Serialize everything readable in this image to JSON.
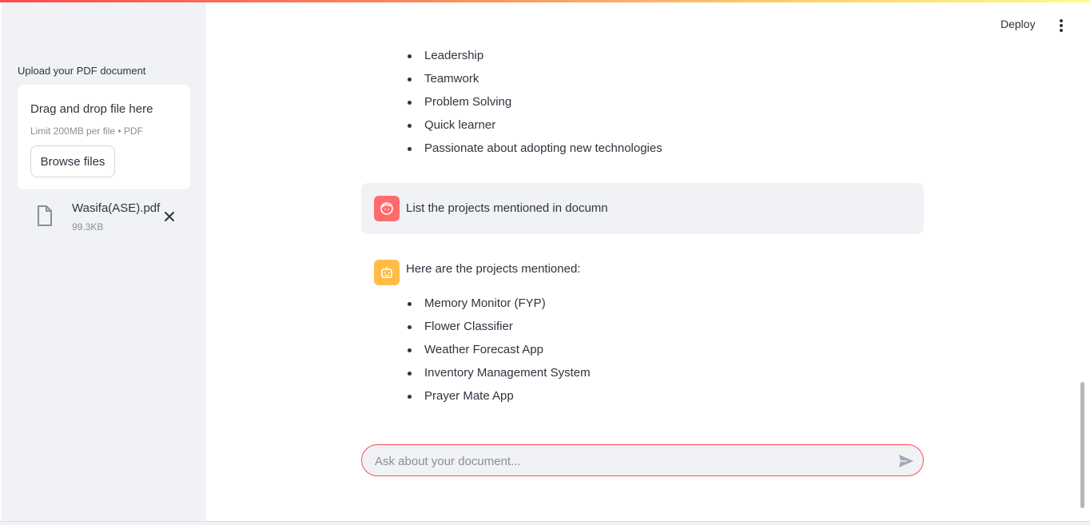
{
  "header": {
    "deploy_label": "Deploy",
    "menu_icon": "kebab-menu-icon"
  },
  "sidebar": {
    "upload_label": "Upload your PDF document",
    "dropzone": {
      "title": "Drag and drop file here",
      "limit": "Limit 200MB per file • PDF",
      "browse_label": "Browse files"
    },
    "file": {
      "name": "Wasifa(ASE).pdf",
      "size": "99.3KB",
      "icon": "file-icon",
      "remove_icon": "close-icon"
    }
  },
  "chat": {
    "previous_bullets": [
      "Leadership",
      "Teamwork",
      "Problem Solving",
      "Quick learner",
      "Passionate about adopting new technologies"
    ],
    "user_message": {
      "avatar_icon": "user-avatar-icon",
      "text": "List the projects mentioned in documn"
    },
    "assistant_message": {
      "avatar_icon": "bot-avatar-icon",
      "intro": "Here are the projects mentioned:",
      "bullets": [
        "Memory Monitor (FYP)",
        "Flower Classifier",
        "Weather Forecast App",
        "Inventory Management System",
        "Prayer Mate App"
      ]
    },
    "input": {
      "placeholder": "Ask about your document...",
      "value": ""
    },
    "send_icon": "send-icon"
  },
  "colors": {
    "accent": "#ff4b4b",
    "user_avatar": "#ff6b6b",
    "bot_avatar": "#ffbd45",
    "sidebar_bg": "#f0f2f6"
  }
}
